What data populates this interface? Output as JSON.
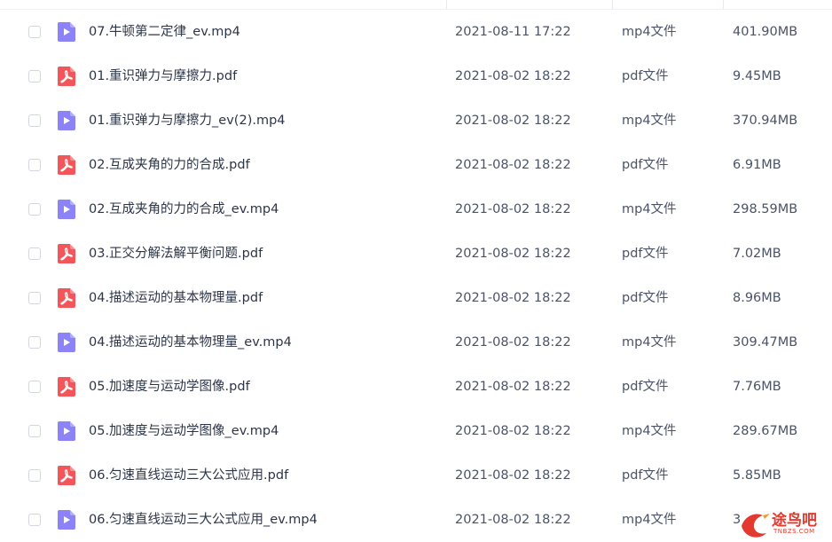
{
  "files": [
    {
      "name": "07.牛顿第二定律_ev.mp4",
      "date": "2021-08-11 17:22",
      "type": "mp4文件",
      "size": "401.90MB",
      "kind": "video"
    },
    {
      "name": "01.重识弹力与摩擦力.pdf",
      "date": "2021-08-02 18:22",
      "type": "pdf文件",
      "size": "9.45MB",
      "kind": "pdf"
    },
    {
      "name": "01.重识弹力与摩擦力_ev(2).mp4",
      "date": "2021-08-02 18:22",
      "type": "mp4文件",
      "size": "370.94MB",
      "kind": "video"
    },
    {
      "name": "02.互成夹角的力的合成.pdf",
      "date": "2021-08-02 18:22",
      "type": "pdf文件",
      "size": "6.91MB",
      "kind": "pdf"
    },
    {
      "name": "02.互成夹角的力的合成_ev.mp4",
      "date": "2021-08-02 18:22",
      "type": "mp4文件",
      "size": "298.59MB",
      "kind": "video"
    },
    {
      "name": "03.正交分解法解平衡问题.pdf",
      "date": "2021-08-02 18:22",
      "type": "pdf文件",
      "size": "7.02MB",
      "kind": "pdf"
    },
    {
      "name": "04.描述运动的基本物理量.pdf",
      "date": "2021-08-02 18:22",
      "type": "pdf文件",
      "size": "8.96MB",
      "kind": "pdf"
    },
    {
      "name": "04.描述运动的基本物理量_ev.mp4",
      "date": "2021-08-02 18:22",
      "type": "mp4文件",
      "size": "309.47MB",
      "kind": "video"
    },
    {
      "name": "05.加速度与运动学图像.pdf",
      "date": "2021-08-02 18:22",
      "type": "pdf文件",
      "size": "7.76MB",
      "kind": "pdf"
    },
    {
      "name": "05.加速度与运动学图像_ev.mp4",
      "date": "2021-08-02 18:22",
      "type": "mp4文件",
      "size": "289.67MB",
      "kind": "video"
    },
    {
      "name": "06.匀速直线运动三大公式应用.pdf",
      "date": "2021-08-02 18:22",
      "type": "pdf文件",
      "size": "5.85MB",
      "kind": "pdf"
    },
    {
      "name": "06.匀速直线运动三大公式应用_ev.mp4",
      "date": "2021-08-02 18:22",
      "type": "mp4文件",
      "size": "3",
      "kind": "video"
    }
  ],
  "icons": {
    "video": {
      "name": "video-file-icon",
      "color": "#8b83f7"
    },
    "pdf": {
      "name": "pdf-file-icon",
      "color": "#f2565b"
    }
  },
  "watermark": {
    "title": "途鸟吧",
    "subtitle": "TNBZS.COM",
    "color": "#e4392f"
  }
}
